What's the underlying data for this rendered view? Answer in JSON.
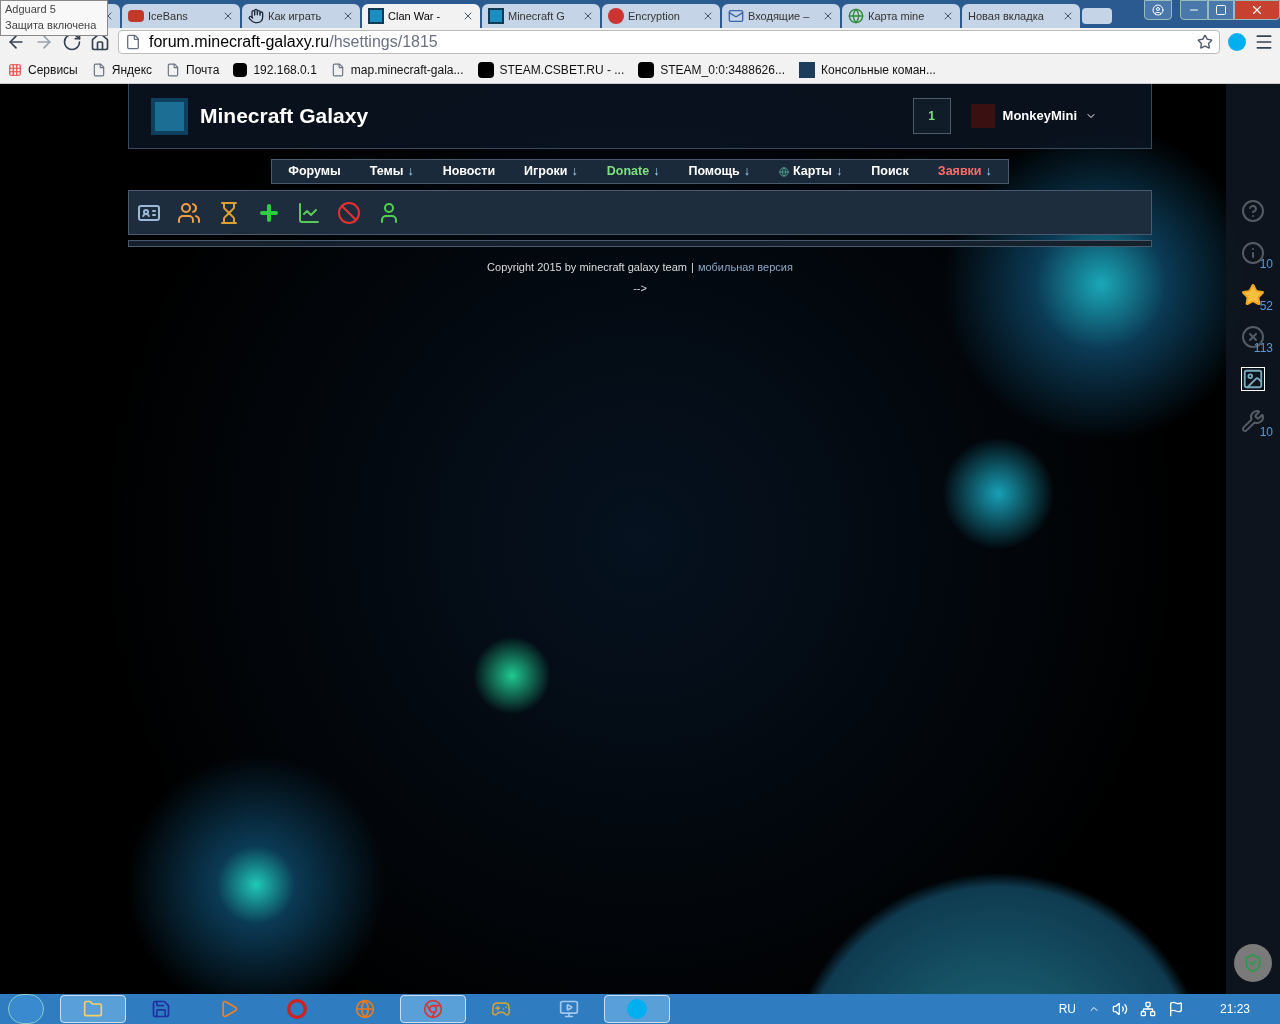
{
  "tooltip": {
    "title": "Adguard 5",
    "text": "Защита включена"
  },
  "tabs": [
    {
      "selected": false
    },
    {
      "title": "IceBans",
      "selected": false
    },
    {
      "title": "Как играть",
      "selected": false
    },
    {
      "title": "Clan War -",
      "selected": true
    },
    {
      "title": "Minecraft G",
      "selected": false
    },
    {
      "title": "Encryption",
      "selected": false
    },
    {
      "title": "Входящие –",
      "selected": false
    },
    {
      "title": "Карта mine",
      "selected": false
    },
    {
      "title": "Новая вкладка",
      "selected": false
    }
  ],
  "address": {
    "host": "forum.minecraft-galaxy.ru",
    "path": "/hsettings/1815"
  },
  "bookmarks": [
    "Сервисы",
    "Яндекс",
    "Почта",
    "192.168.0.1",
    "map.minecraft-gala...",
    "STEAM.CSBET.RU - ...",
    "STEAM_0:0:3488626...",
    "Консольные коман..."
  ],
  "site": {
    "title": "Minecraft Galaxy",
    "notifications": "1",
    "username": "MonkeyMini"
  },
  "nav": [
    {
      "kind": "link",
      "label": "Форумы",
      "color": "#ffffff"
    },
    {
      "kind": "link",
      "label": "Темы",
      "arrow": "↓",
      "color": "#ffffff"
    },
    {
      "kind": "link",
      "label": "Новости",
      "color": "#ffffff"
    },
    {
      "kind": "link",
      "label": "Игроки",
      "arrow": "↓",
      "color": "#ffffff"
    },
    {
      "kind": "link",
      "label": "Donate",
      "arrow": "↓",
      "color": "#7ee07e"
    },
    {
      "kind": "link",
      "label": "Помощь",
      "arrow": "↓",
      "color": "#ffffff"
    },
    {
      "kind": "map",
      "label": "Карты",
      "arrow": "↓",
      "color": "#ffffff"
    },
    {
      "kind": "link",
      "label": "Поиск",
      "color": "#ffffff"
    },
    {
      "kind": "link",
      "label": "Заявки",
      "arrow": "↓",
      "color": "#ff6b6b"
    }
  ],
  "footer": {
    "copyright": "Copyright 2015 by minecraft galaxy team",
    "separator": "|",
    "link": "мобильная версия",
    "comment": "-->"
  },
  "side": [
    {
      "kind": "help"
    },
    {
      "kind": "info",
      "count": "10"
    },
    {
      "kind": "star",
      "count": "52"
    },
    {
      "kind": "close",
      "count": "113"
    },
    {
      "kind": "image"
    },
    {
      "kind": "wrench",
      "count": "10"
    }
  ],
  "taskbar": {
    "apps": [
      {
        "selected": true
      },
      {
        "selected": false
      },
      {
        "selected": false
      },
      {
        "selected": false
      },
      {
        "selected": false
      },
      {
        "selected": true
      },
      {
        "selected": false
      },
      {
        "selected": false
      },
      {
        "selected": true
      }
    ],
    "language": "RU",
    "time": "21:23"
  }
}
